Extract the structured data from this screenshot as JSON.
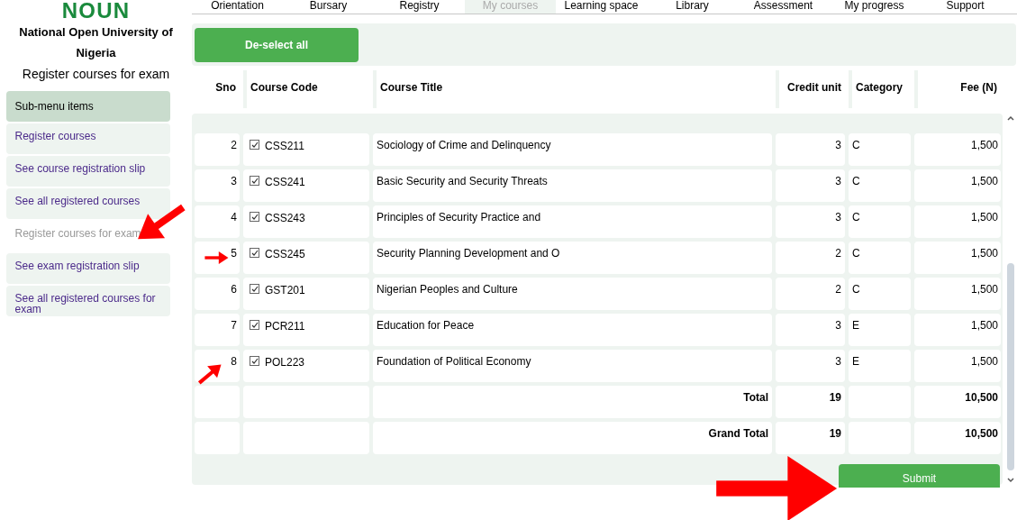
{
  "logo": "NOUN",
  "university": "National Open University of Nigeria",
  "page_title": "Register courses for exam",
  "sidebar": {
    "header": "Sub-menu items",
    "items": [
      {
        "label": "Register courses",
        "selected": false
      },
      {
        "label": "See course registration slip",
        "selected": false
      },
      {
        "label": "See all registered courses",
        "selected": false
      },
      {
        "label": "Register courses for exam",
        "selected": true
      },
      {
        "label": "See exam registration slip",
        "selected": false
      },
      {
        "label": "See all registered courses for exam",
        "selected": false
      }
    ]
  },
  "nav": [
    {
      "label": "Orientation",
      "selected": false
    },
    {
      "label": "Bursary",
      "selected": false
    },
    {
      "label": "Registry",
      "selected": false
    },
    {
      "label": "My courses",
      "selected": true
    },
    {
      "label": "Learning space",
      "selected": false
    },
    {
      "label": "Library",
      "selected": false
    },
    {
      "label": "Assessment",
      "selected": false
    },
    {
      "label": "My progress",
      "selected": false
    },
    {
      "label": "Support",
      "selected": false
    }
  ],
  "deselect_button": "De-select all",
  "table": {
    "columns": [
      "Sno",
      "Course Code",
      "Course Title",
      "Credit unit",
      "Category",
      "Fee (N)"
    ],
    "rows": [
      {
        "sno": "2",
        "code": "CSS211",
        "checked": true,
        "title": "Sociology of Crime and Delinquency",
        "credit": "3",
        "category": "C",
        "fee": "1,500"
      },
      {
        "sno": "3",
        "code": "CSS241",
        "checked": true,
        "title": "Basic Security and Security Threats",
        "credit": "3",
        "category": "C",
        "fee": "1,500"
      },
      {
        "sno": "4",
        "code": "CSS243",
        "checked": true,
        "title": "Principles of Security Practice and",
        "credit": "3",
        "category": "C",
        "fee": "1,500"
      },
      {
        "sno": "5",
        "code": "CSS245",
        "checked": true,
        "title": "Security Planning Development and O",
        "credit": "2",
        "category": "C",
        "fee": "1,500"
      },
      {
        "sno": "6",
        "code": "GST201",
        "checked": true,
        "title": "Nigerian Peoples and Culture",
        "credit": "2",
        "category": "C",
        "fee": "1,500"
      },
      {
        "sno": "7",
        "code": "PCR211",
        "checked": true,
        "title": "Education for Peace",
        "credit": "3",
        "category": "E",
        "fee": "1,500"
      },
      {
        "sno": "8",
        "code": "POL223",
        "checked": true,
        "title": "Foundation of Political Economy",
        "credit": "3",
        "category": "E",
        "fee": "1,500"
      }
    ],
    "totals": [
      {
        "label": "Total",
        "credit": "19",
        "fee": "10,500"
      },
      {
        "label": "Grand Total",
        "credit": "19",
        "fee": "10,500"
      }
    ]
  },
  "submit_button": "Submit"
}
